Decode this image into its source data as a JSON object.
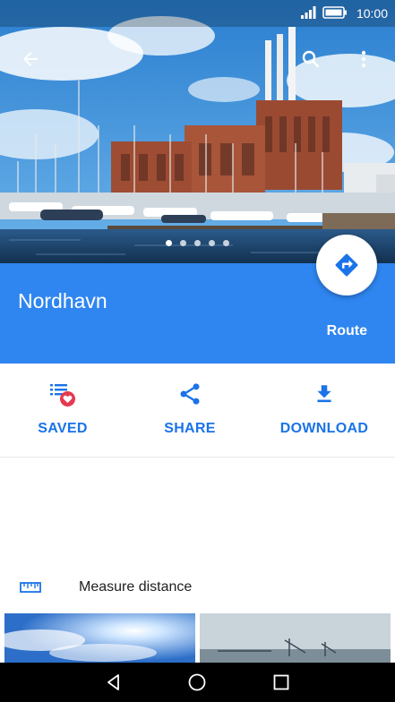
{
  "status_bar": {
    "time": "10:00"
  },
  "hero": {
    "carousel_count": 5,
    "active_index": 0
  },
  "place": {
    "name": "Nordhavn",
    "route_label": "Route"
  },
  "actions": [
    {
      "label": "SAVED",
      "icon": "saved-list-icon"
    },
    {
      "label": "SHARE",
      "icon": "share-icon"
    },
    {
      "label": "DOWNLOAD",
      "icon": "download-icon"
    }
  ],
  "measure": {
    "label": "Measure distance",
    "icon": "ruler-icon"
  },
  "colors": {
    "accent": "#2f86f0",
    "link": "#1a73e8",
    "heart": "#e53950"
  }
}
